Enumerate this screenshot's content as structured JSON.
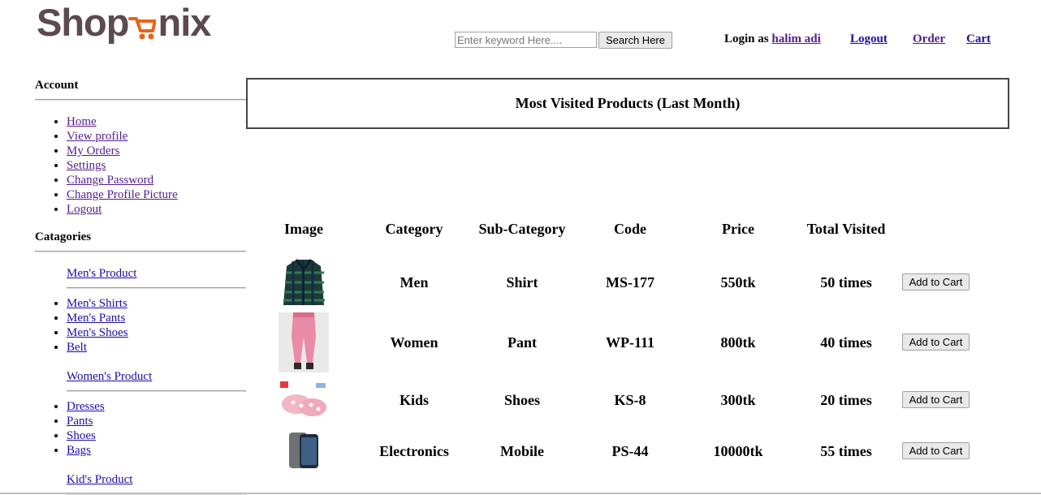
{
  "logo": {
    "part1": "Shop",
    "part2": "nix"
  },
  "header": {
    "search_placeholder": "Enter keyword Here....",
    "search_button": "Search Here",
    "login_prefix": "Login as ",
    "user_name": "halim adi",
    "nav": {
      "logout": "Logout",
      "order": "Order",
      "cart": "Cart"
    }
  },
  "sidebar": {
    "account_heading": "Account",
    "account_links": [
      "Home",
      "View profile",
      "My Orders",
      "Settings",
      "Change Password",
      "Change Profile Picture",
      "Logout"
    ],
    "categories_heading": "Catagories",
    "mens": {
      "title": "Men's Product",
      "items": [
        "Men's Shirts",
        "Men's Pants",
        "Men's Shoes",
        "Belt"
      ]
    },
    "womens": {
      "title": "Women's Product",
      "items": [
        "Dresses",
        "Pants",
        "Shoes",
        "Bags"
      ]
    },
    "kids": {
      "title": "Kid's Product"
    }
  },
  "main": {
    "title": "Most Visited Products (Last Month)",
    "columns": [
      "Image",
      "Category",
      "Sub-Category",
      "Code",
      "Price",
      "Total Visited"
    ],
    "add_to_cart": "Add to Cart",
    "rows": [
      {
        "category": "Men",
        "subcategory": "Shirt",
        "code": "MS-177",
        "price": "550tk",
        "visited": "50 times"
      },
      {
        "category": "Women",
        "subcategory": "Pant",
        "code": "WP-111",
        "price": "800tk",
        "visited": "40 times"
      },
      {
        "category": "Kids",
        "subcategory": "Shoes",
        "code": "KS-8",
        "price": "300tk",
        "visited": "20 times"
      },
      {
        "category": "Electronics",
        "subcategory": "Mobile",
        "code": "PS-44",
        "price": "10000tk",
        "visited": "55 times"
      }
    ]
  },
  "colors": {
    "logo_text": "#5b4a50",
    "logo_accent": "#e8641b",
    "link": "#1a0dab",
    "visited_link": "#551a8b"
  }
}
